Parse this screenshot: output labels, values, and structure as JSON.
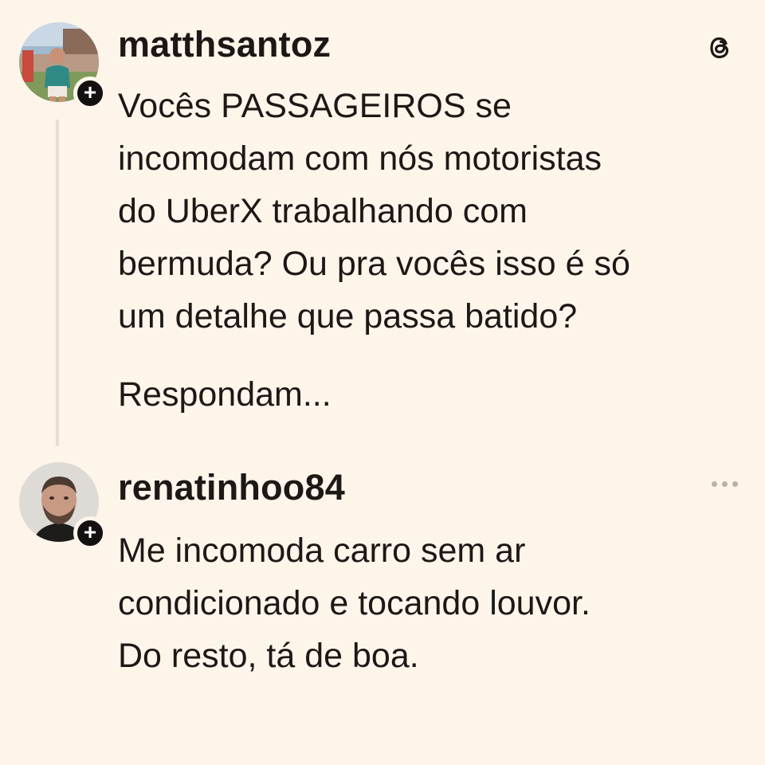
{
  "posts": [
    {
      "username": "matthsantoz",
      "text": "Vocês PASSAGEIROS se\nincomodam com nós motoristas\ndo UberX trabalhando com\nbermuda? Ou pra vocês isso é só\num detalhe que passa batido?",
      "text_2": "Respondam...",
      "avatar_icon": "profile-photo-outdoor-icon",
      "follow_icon": "plus-icon",
      "corner_icon": "threads-logo-icon"
    },
    {
      "username": "renatinhoo84",
      "text": "Me incomoda carro sem ar\ncondicionado e tocando louvor.\nDo resto, tá de boa.",
      "avatar_icon": "profile-photo-portrait-icon",
      "follow_icon": "plus-icon",
      "corner_icon": "more-options-icon"
    }
  ],
  "colors": {
    "background": "#fdf5ea",
    "text": "#1d1815",
    "badge": "#141010",
    "thread_line": "#e8ddd0",
    "muted_icon": "#b9b1a8"
  }
}
